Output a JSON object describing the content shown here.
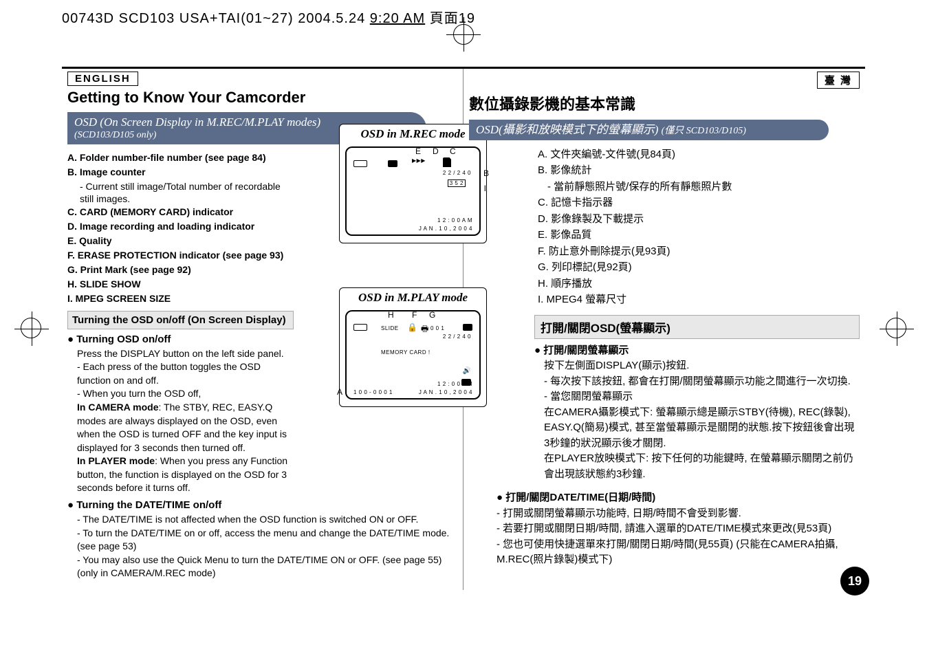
{
  "header_line": {
    "prefix": "00743D SCD103 USA+TAI(01~27) 2004.5.24 ",
    "time": "9:20 AM",
    "page_label": "頁面",
    "page_num": "19"
  },
  "left": {
    "lang": "ENGLISH",
    "heading": "Getting to Know Your Camcorder",
    "subheader_main": "OSD (On Screen Display in M.REC/M.PLAY modes)",
    "subheader_small": "(SCD103/D105 only)",
    "items": {
      "A": "Folder number-file number (see page 84)",
      "B": "Image counter",
      "B_sub": "- Current still image/Total number of recordable still images.",
      "C": "CARD (MEMORY CARD) indicator",
      "D": "Image recording and loading indicator",
      "E": "Quality",
      "F": "ERASE PROTECTION indicator (see page 93)",
      "G": "Print Mark (see page 92)",
      "H": "SLIDE SHOW",
      "I": "MPEG SCREEN SIZE"
    },
    "section1_title": "Turning the OSD on/off (On Screen Display)",
    "bp1_title": "Turning OSD on/off",
    "bp1_body1": "Press the DISPLAY button on the left side panel.",
    "bp1_body2": "- Each press of the button toggles the OSD function on and off.",
    "bp1_body3": "- When you turn the OSD off,",
    "bp1_body4": "In CAMERA mode: The STBY, REC, EASY.Q modes are always displayed on the OSD, even when the OSD is turned OFF and the key input is displayed for 3 seconds then turned off.",
    "bp1_body5": "In PLAYER mode: When you press any Function button, the function is displayed on the OSD for 3 seconds before it turns off.",
    "bp2_title": "Turning the DATE/TIME on/off",
    "bp2_body1": "- The DATE/TIME is not affected when the OSD function is switched ON or OFF.",
    "bp2_body2": "- To turn the DATE/TIME on or off, access the menu and change the DATE/TIME mode. (see page 53)",
    "bp2_body3": "- You may also use the Quick Menu to turn the DATE/TIME ON or OFF. (see page 55) (only in CAMERA/M.REC mode)"
  },
  "diagrams": {
    "diag1_title": "OSD in M.REC mode",
    "diag2_title": "OSD in M.PLAY mode",
    "diag1_labels": {
      "E": "E",
      "D": "D",
      "C": "C",
      "B": "B",
      "I": "I"
    },
    "diag1_text": {
      "counter": "2 2 / 2 4 0",
      "size": "3 5 2",
      "time": "1 2 : 0 0 A M",
      "date": "J A N . 1 0 , 2 0 0 4"
    },
    "diag2_labels": {
      "H": "H",
      "F": "F",
      "G": "G",
      "A": "A"
    },
    "diag2_text": {
      "slide": "SLIDE",
      "pm": "0 0 1",
      "counter": "2 2 / 2 4 0",
      "card": "MEMORY CARD !",
      "folder": "1 0 0 - 0 0 0 1",
      "time": "1 2 : 0 0 A M",
      "date": "J A N . 1 0 , 2 0 0 4"
    }
  },
  "right": {
    "lang": "臺 灣",
    "heading": "數位攝錄影機的基本常識",
    "subheader_main": "OSD(攝影和放映模式下的螢幕顯示)",
    "subheader_small": "(僅只 SCD103/D105)",
    "items": {
      "A": "A. 文件夾編號-文件號(見84頁)",
      "B": "B. 影像統計",
      "B_sub": "- 當前靜態照片號/保存的所有靜態照片數",
      "C": "C. 記憶卡指示器",
      "D": "D. 影像錄製及下載提示",
      "E": "E. 影像品質",
      "F": "F. 防止意外刪除提示(見93頁)",
      "G": "G. 列印標記(見92頁)",
      "H": "H. 順序播放",
      "I": "I. MPEG4 螢幕尺寸"
    },
    "section1_title": "打開/關閉OSD(螢幕顯示)",
    "bp1_title": "打開/關閉螢幕顯示",
    "bp1_1": "按下左側面DISPLAY(顯示)按鈕.",
    "bp1_2": "- 每次按下該按鈕, 都會在打開/關閉螢幕顯示功能之間進行一次切換.",
    "bp1_3": "- 當您關閉螢幕顯示",
    "bp1_4": "在CAMERA攝影模式下: 螢幕顯示總是顯示STBY(待機), REC(錄製), EASY.Q(簡易)模式, 甚至當螢幕顯示是關閉的狀態.按下按鈕後會出現3秒鐘的狀況顯示後才關閉.",
    "bp1_5": "在PLAYER放映模式下: 按下任何的功能鍵時, 在螢幕顯示關閉之前仍會出現該狀態約3秒鐘.",
    "bp2_title": "打開/關閉DATE/TIME(日期/時間)",
    "bp2_1": "- 打開或關閉螢幕顯示功能時, 日期/時間不會受到影響.",
    "bp2_2": "- 若要打開或關閉日期/時間, 請進入選單的DATE/TIME模式來更改(見53頁)",
    "bp2_3": "- 您也可使用快捷選單來打開/關閉日期/時間(見55頁) (只能在CAMERA拍攝, M.REC(照片錄製)模式下)"
  },
  "page_number": "19"
}
